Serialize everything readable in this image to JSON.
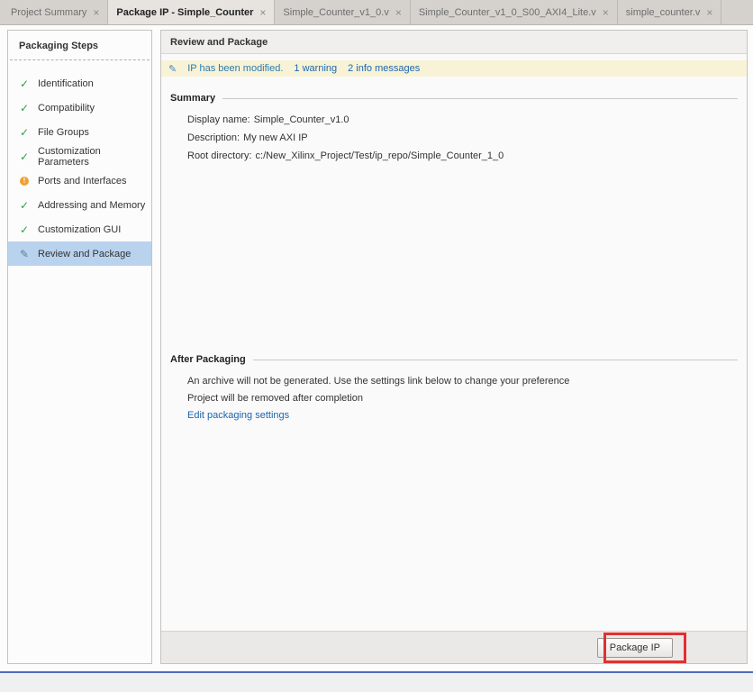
{
  "tabs": [
    {
      "label": "Project Summary",
      "active": false
    },
    {
      "label": "Package IP - Simple_Counter",
      "active": true
    },
    {
      "label": "Simple_Counter_v1_0.v",
      "active": false
    },
    {
      "label": "Simple_Counter_v1_0_S00_AXI4_Lite.v",
      "active": false
    },
    {
      "label": "simple_counter.v",
      "active": false
    }
  ],
  "close_icon": "×",
  "sidebar": {
    "title": "Packaging Steps",
    "items": [
      {
        "label": "Identification",
        "icon": "check-icon"
      },
      {
        "label": "Compatibility",
        "icon": "check-icon"
      },
      {
        "label": "File Groups",
        "icon": "check-icon"
      },
      {
        "label": "Customization Parameters",
        "icon": "check-icon"
      },
      {
        "label": "Ports and Interfaces",
        "icon": "warning-icon"
      },
      {
        "label": "Addressing and Memory",
        "icon": "check-icon"
      },
      {
        "label": "Customization GUI",
        "icon": "check-icon"
      },
      {
        "label": "Review and Package",
        "icon": "pencil-icon",
        "selected": true
      }
    ]
  },
  "main": {
    "title": "Review and Package",
    "notification": {
      "modified_text": "IP has been modified.",
      "warning_link": "1 warning",
      "info_link": "2 info messages"
    },
    "summary": {
      "title": "Summary",
      "fields": [
        {
          "label": "Display name:",
          "value": "Simple_Counter_v1.0"
        },
        {
          "label": "Description:",
          "value": "My new AXI IP"
        },
        {
          "label": "Root directory:",
          "value": "c:/New_Xilinx_Project/Test/ip_repo/Simple_Counter_1_0"
        }
      ]
    },
    "after_packaging": {
      "title": "After Packaging",
      "lines": [
        "An archive will not be generated. Use the settings link below to change your preference",
        "Project will be removed after completion"
      ],
      "link": "Edit packaging settings"
    },
    "package_button": "Package IP"
  },
  "colors": {
    "selection_blue": "#b9d3ee",
    "notification_yellow": "#f8f3d6",
    "link_blue": "#1a66b0",
    "check_green": "#2f9e44",
    "warning_orange": "#f0a030",
    "annotation_red": "#e03131",
    "divider_blue": "#4f6db8"
  }
}
